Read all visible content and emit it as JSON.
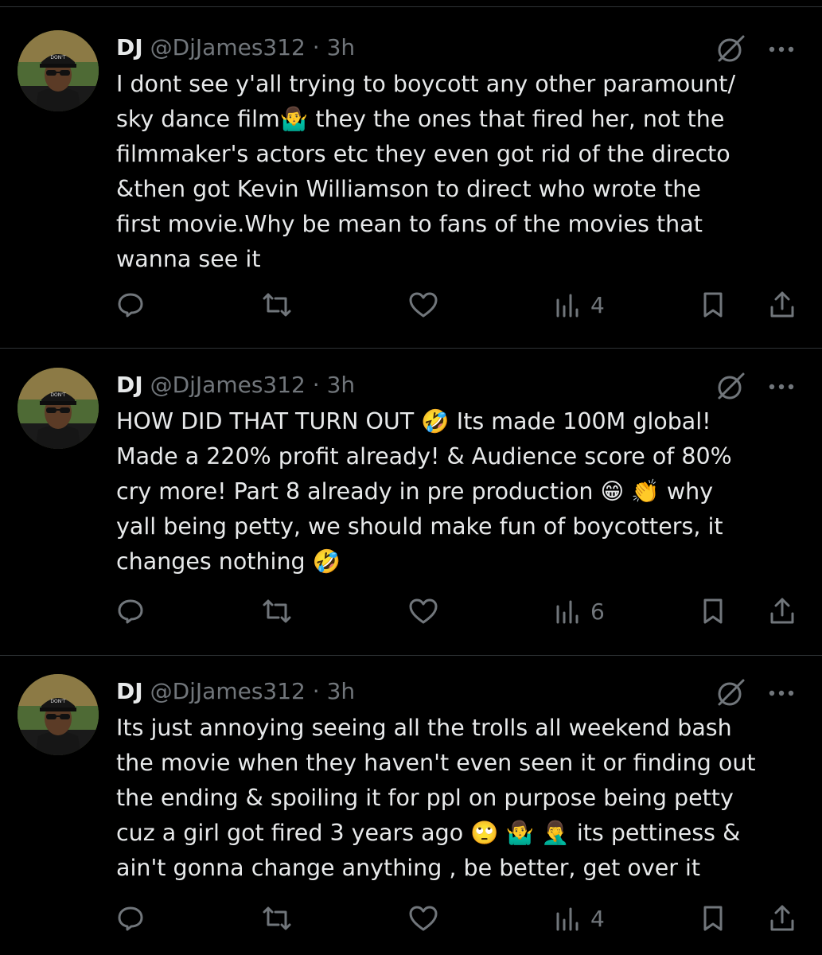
{
  "tweets": [
    {
      "name": "DJ",
      "handle": "@DjJames312",
      "dot": "·",
      "time": "3h",
      "lines": [
        "I dont see y'all trying to boycott any other paramount/",
        "sky dance film🤷‍♂️ they the ones that fired her, not the",
        "filmmaker's actors etc they even got rid of the directo",
        "&then got Kevin Williamson to direct who wrote the",
        "first movie.Why be mean to fans of the movies that",
        "wanna see it"
      ],
      "views": "4"
    },
    {
      "name": "DJ",
      "handle": "@DjJames312",
      "dot": "·",
      "time": "3h",
      "lines": [
        "HOW DID THAT TURN OUT 🤣 Its made 100M global!",
        "Made a 220% profit already! & Audience score of 80%",
        "cry more! Part 8 already in pre production 😁 👏 why",
        "yall being petty, we should make fun of boycotters, it",
        "changes nothing 🤣"
      ],
      "views": "6"
    },
    {
      "name": "DJ",
      "handle": "@DjJames312",
      "dot": "·",
      "time": "3h",
      "lines": [
        "Its just annoying seeing all the trolls all weekend bash",
        "the movie when they haven't even seen it or finding out",
        "the ending & spoiling it for ppl on purpose being petty",
        "cuz a girl got fired 3 years ago 🙄 🤷‍♂️ 🤦‍♂️ its pettiness &",
        "ain't gonna change anything , be better, get over it"
      ],
      "views": "4"
    }
  ],
  "icons": {
    "reply": "reply-icon",
    "repost": "repost-icon",
    "like": "like-icon",
    "views": "views-icon",
    "bookmark": "bookmark-icon",
    "share": "share-icon",
    "grok": "grok-icon",
    "more": "more-icon"
  },
  "colors": {
    "background": "#000000",
    "text": "#e7e9ea",
    "secondary": "#71767b",
    "divider": "#2f3336"
  }
}
